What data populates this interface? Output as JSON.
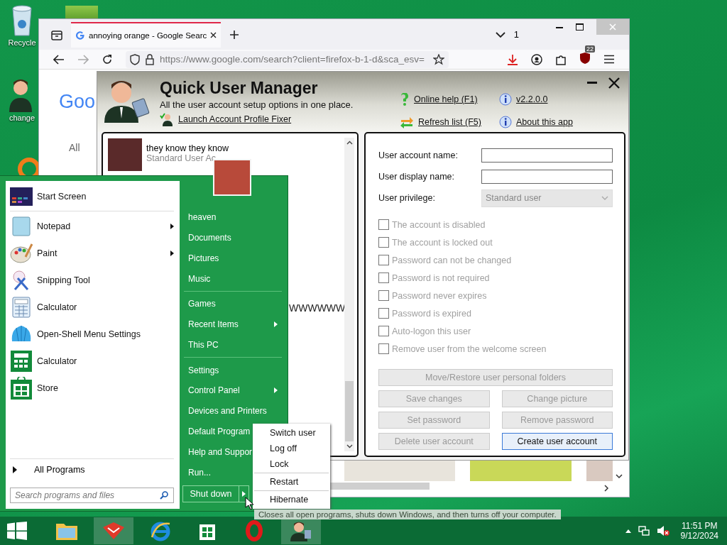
{
  "desktop_icons": [
    {
      "label": "Recycle"
    },
    {
      "label": "change"
    }
  ],
  "browser": {
    "tab_title": "annoying orange - Google Searc",
    "tab_count": "1",
    "url": "https://www.google.com/search?client=firefox-b-1-d&sca_esv=",
    "blocker_badge": "22",
    "logo": "Goo",
    "filter_tab": "All"
  },
  "app": {
    "title": "Quick User Manager",
    "subtitle": "All the user account setup options in one place.",
    "fixer_link": "Launch Account Profile Fixer",
    "links": [
      {
        "kind": "help",
        "label": "Online help (F1)"
      },
      {
        "kind": "info",
        "label": "v2.2.0.0"
      },
      {
        "kind": "refresh",
        "label": "Refresh list (F5)"
      },
      {
        "kind": "info",
        "label": "About this app"
      }
    ],
    "users": [
      {
        "name": "they know they know",
        "type": "Standard User Ac"
      }
    ],
    "list_text": "WWWWWW",
    "fields": [
      {
        "label": "User account name:",
        "kind": "text"
      },
      {
        "label": "User display name:",
        "kind": "text"
      },
      {
        "label": "User privilege:",
        "kind": "select",
        "value": "Standard user"
      }
    ],
    "options": [
      {
        "label": "The account is disabled",
        "checked": false,
        "disabled": true
      },
      {
        "label": "The account is locked out",
        "checked": false,
        "disabled": true
      },
      {
        "label": "Password can not be changed",
        "checked": false,
        "disabled": true
      },
      {
        "label": "Password is not required",
        "checked": false,
        "disabled": true
      },
      {
        "label": "Password never expires",
        "checked": false,
        "disabled": true
      },
      {
        "label": "Password is expired",
        "checked": false,
        "disabled": true
      },
      {
        "label": "Auto-logon this user",
        "checked": false,
        "disabled": true
      },
      {
        "label": "Remove user from the welcome screen",
        "checked": false,
        "disabled": true
      }
    ],
    "wide_button": {
      "label": "Move/Restore user personal folders",
      "disabled": true
    },
    "buttons": [
      {
        "label": "Save changes",
        "disabled": true,
        "focused": false
      },
      {
        "label": "Change picture",
        "disabled": true,
        "focused": false
      },
      {
        "label": "Set password",
        "disabled": true,
        "focused": false
      },
      {
        "label": "Remove password",
        "disabled": true,
        "focused": false
      },
      {
        "label": "Delete user account",
        "disabled": true,
        "focused": false
      },
      {
        "label": "Create user account",
        "disabled": false,
        "focused": true
      }
    ]
  },
  "start_menu": {
    "programs": [
      {
        "label": "Start Screen",
        "submenu": false
      },
      {
        "label": "Notepad",
        "submenu": true
      },
      {
        "label": "Paint",
        "submenu": true
      },
      {
        "label": "Snipping Tool",
        "submenu": false
      },
      {
        "label": "Calculator",
        "submenu": false
      },
      {
        "label": "Open-Shell Menu Settings",
        "submenu": false
      },
      {
        "label": "Calculator",
        "submenu": false
      },
      {
        "label": "Store",
        "submenu": false
      }
    ],
    "all_programs": "All Programs",
    "search_placeholder": "Search programs and files",
    "places": [
      [
        {
          "label": "heaven",
          "submenu": false
        },
        {
          "label": "Documents",
          "submenu": false
        },
        {
          "label": "Pictures",
          "submenu": false
        },
        {
          "label": "Music",
          "submenu": false
        }
      ],
      [
        {
          "label": "Games",
          "submenu": false
        },
        {
          "label": "Recent Items",
          "submenu": true
        },
        {
          "label": "This PC",
          "submenu": false
        }
      ],
      [
        {
          "label": "Settings",
          "submenu": false
        },
        {
          "label": "Control Panel",
          "submenu": true
        },
        {
          "label": "Devices and Printers",
          "submenu": false
        },
        {
          "label": "Default Program",
          "submenu": false
        },
        {
          "label": "Help and Suppor",
          "submenu": false
        },
        {
          "label": "Run...",
          "submenu": false
        }
      ]
    ],
    "shutdown": "Shut down",
    "shutdown_options": [
      [
        "Switch user",
        "Log off",
        "Lock"
      ],
      [
        "Restart"
      ],
      [
        "Hibernate"
      ]
    ],
    "tooltip": "Closes all open programs, shuts down Windows, and then turns off your computer."
  },
  "taskbar": {
    "apps": [
      {
        "selected": false
      },
      {
        "selected": true
      },
      {
        "selected": false
      },
      {
        "selected": false
      },
      {
        "selected": false
      },
      {
        "selected": true
      }
    ],
    "time": "11:51 PM",
    "date": "9/12/2024"
  }
}
